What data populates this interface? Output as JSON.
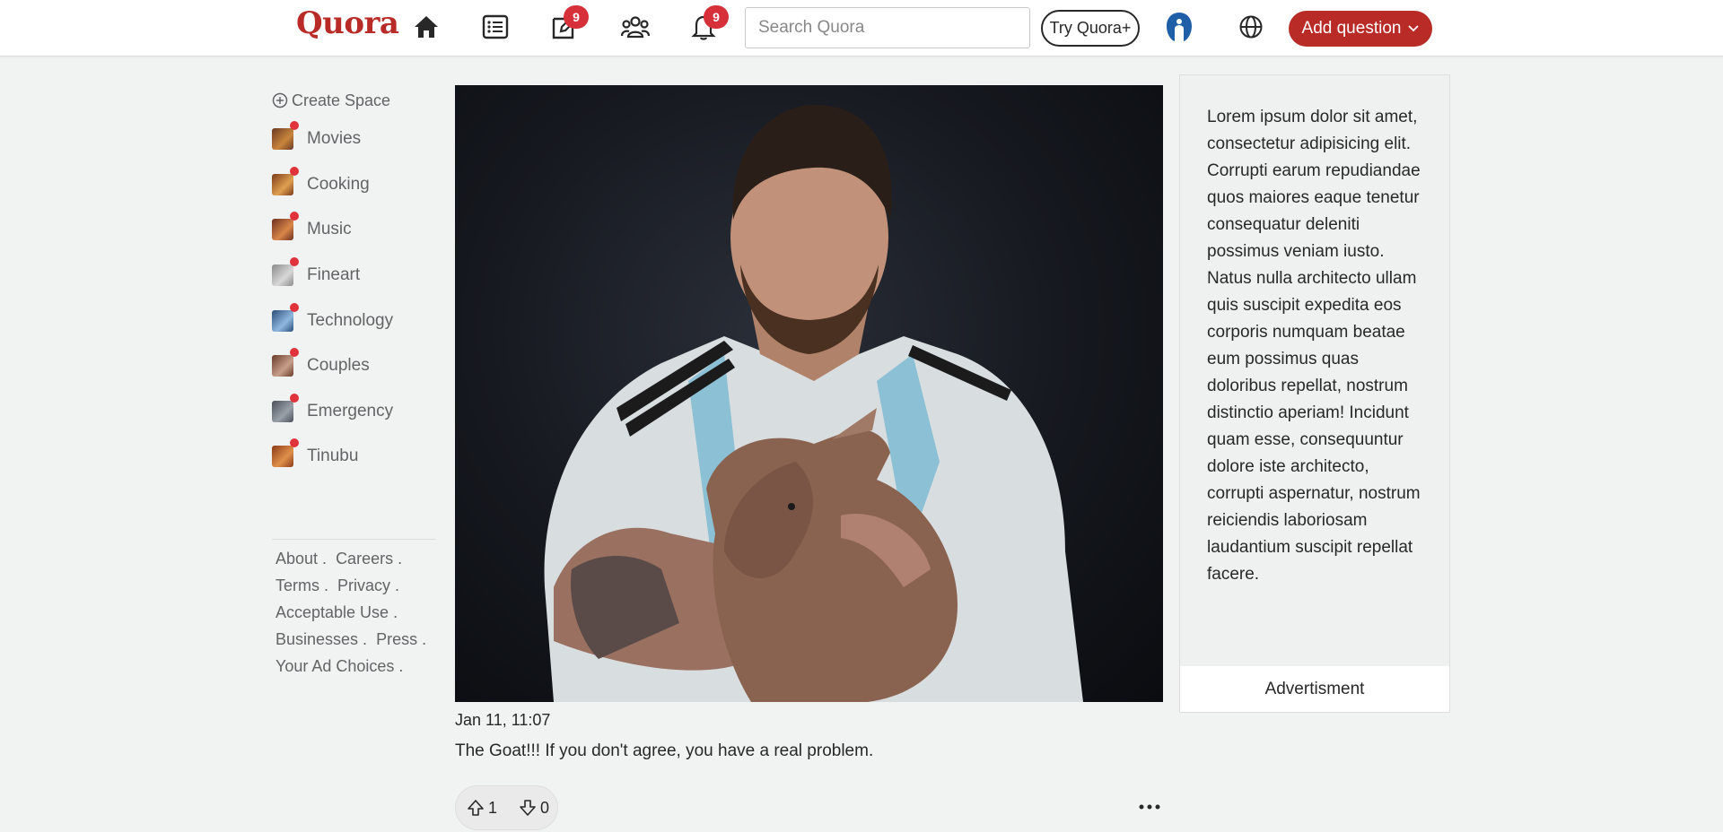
{
  "header": {
    "logo": "Quora",
    "nav": [
      {
        "name": "home-icon"
      },
      {
        "name": "following-icon"
      },
      {
        "name": "answer-icon",
        "badge": "9"
      },
      {
        "name": "spaces-icon"
      },
      {
        "name": "notifications-icon",
        "badge": "9"
      }
    ],
    "search_placeholder": "Search Quora",
    "try_label": "Try Quora+",
    "add_question_label": "Add question",
    "colors": {
      "brand": "#b92b27",
      "badge": "#d6313a"
    }
  },
  "sidebar": {
    "create_space": "Create Space",
    "spaces": [
      {
        "label": "Movies",
        "color_a": "#6b3a26",
        "color_b": "#c9853c"
      },
      {
        "label": "Cooking",
        "color_a": "#7a3b1c",
        "color_b": "#e0a050"
      },
      {
        "label": "Music",
        "color_a": "#6d2f1e",
        "color_b": "#d9874a"
      },
      {
        "label": "Fineart",
        "color_a": "#8a8a8a",
        "color_b": "#d8d8d8"
      },
      {
        "label": "Technology",
        "color_a": "#2a4f7a",
        "color_b": "#8fb8e0"
      },
      {
        "label": "Couples",
        "color_a": "#6a3a2a",
        "color_b": "#c7a08a"
      },
      {
        "label": "Emergency",
        "color_a": "#4a4f5a",
        "color_b": "#9aa0a8"
      },
      {
        "label": "Tinubu",
        "color_a": "#8a3a18",
        "color_b": "#e0904a"
      }
    ],
    "footer": {
      "about": "About .",
      "careers": "Careers .",
      "terms": "Terms .",
      "privacy": "Privacy .",
      "acceptable_use": "Acceptable Use .",
      "businesses": "Businesses .",
      "press": "Press .",
      "ad_choices": "Your Ad Choices ."
    }
  },
  "post": {
    "date": "Jan 11, 11:07",
    "text": "The Goat!!! If you don't agree, you have a real problem.",
    "upvotes": "1",
    "downvotes": "0"
  },
  "ad": {
    "text": "Lorem ipsum dolor sit amet, consectetur adipisicing elit. Corrupti earum repudiandae quos maiores eaque tenetur consequatur deleniti possimus veniam iusto. Natus nulla architecto ullam quis suscipit expedita eos corporis numquam beatae eum possimus quas doloribus repellat, nostrum distinctio aperiam! Incidunt quam esse, consequuntur dolore iste architecto, corrupti aspernatur, nostrum reiciendis laboriosam laudantium suscipit repellat facere.",
    "footer": "Advertisment"
  }
}
